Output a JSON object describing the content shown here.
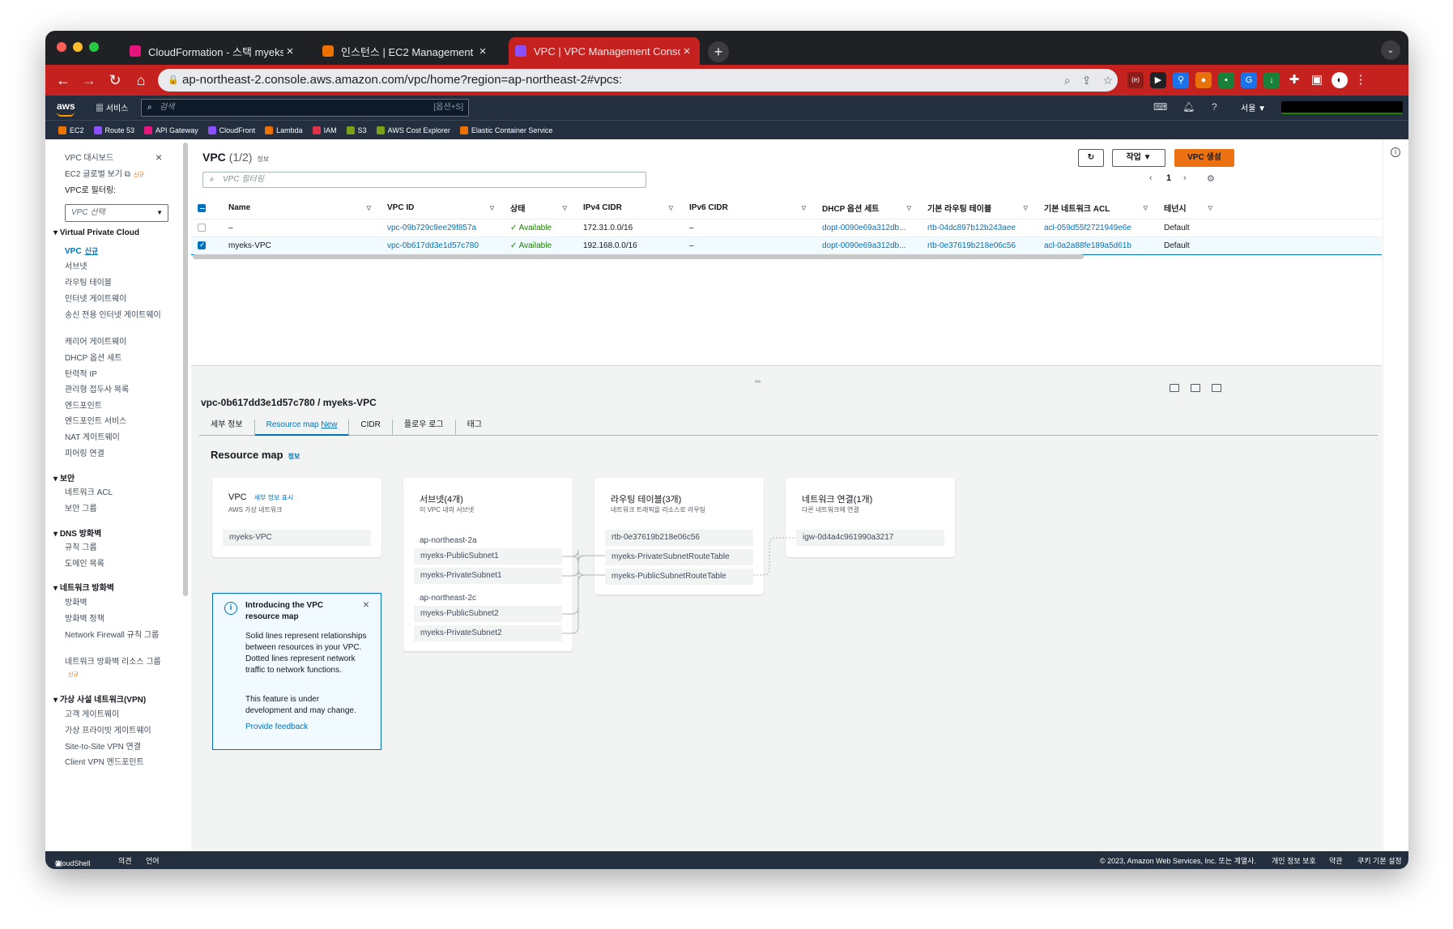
{
  "browser": {
    "tabs": [
      {
        "title": "CloudFormation - 스택 myeks",
        "color": "#e7157b"
      },
      {
        "title": "인스턴스 | EC2 Management Cor",
        "color": "#ed7100"
      },
      {
        "title": "VPC | VPC Management Conso",
        "color": "#8c4fff"
      }
    ],
    "url": "ap-northeast-2.console.aws.amazon.com/vpc/home?region=ap-northeast-2#vpcs:"
  },
  "aws_nav": {
    "logo": "aws",
    "services": "서비스",
    "search_placeholder": "검색",
    "search_shortcut": "[옵션+S]",
    "region": "서울 ▼"
  },
  "favorites": [
    {
      "label": "EC2",
      "color": "#ed7100"
    },
    {
      "label": "Route 53",
      "color": "#8c4fff"
    },
    {
      "label": "API Gateway",
      "color": "#e7157b"
    },
    {
      "label": "CloudFront",
      "color": "#8c4fff"
    },
    {
      "label": "Lambda",
      "color": "#ed7100"
    },
    {
      "label": "IAM",
      "color": "#dd344c"
    },
    {
      "label": "S3",
      "color": "#7aa116"
    },
    {
      "label": "AWS Cost Explorer",
      "color": "#7aa116"
    },
    {
      "label": "Elastic Container Service",
      "color": "#ed7100"
    }
  ],
  "sidebar": {
    "dashboard": "VPC 대시보드",
    "ec2_global": "EC2 글로벌 보기",
    "new_tag": "신규",
    "filter_label": "VPC로 필터링:",
    "filter_select": "VPC 선택",
    "sections": {
      "vpc": "Virtual Private Cloud",
      "security": "보안",
      "dns": "DNS 방화벽",
      "firewall": "네트워크 방화벽",
      "vpn": "가상 사설 네트워크(VPN)"
    },
    "vpc_items": [
      "VPC",
      "서브넷",
      "라우팅 테이블",
      "인터넷 게이트웨이",
      "송신 전용 인터넷 게이트웨이",
      "캐리어 게이트웨이",
      "DHCP 옵션 세트",
      "탄력적 IP",
      "관리형 접두사 목록",
      "엔드포인트",
      "엔드포인트 서비스",
      "NAT 게이트웨이",
      "피어링 연결"
    ],
    "security_items": [
      "네트워크 ACL",
      "보안 그룹"
    ],
    "dns_items": [
      "규칙 그룹",
      "도메인 목록"
    ],
    "firewall_items": [
      "방화벽",
      "방화벽 정책",
      "Network Firewall 규칙 그룹",
      "네트워크 방화벽 리소스 그룹"
    ],
    "vpn_items": [
      "고객 게이트웨이",
      "가상 프라이빗 게이트웨이",
      "Site-to-Site VPN 연결",
      "Client VPN 엔드포인트"
    ]
  },
  "vpc_list": {
    "title": "VPC",
    "count": "(1/2)",
    "info": "정보",
    "filter_placeholder": "VPC 필터링",
    "actions": "작업",
    "create": "VPC 생성",
    "page": "1",
    "columns": [
      "Name",
      "VPC ID",
      "상태",
      "IPv4 CIDR",
      "IPv6 CIDR",
      "DHCP 옵션 세트",
      "기본 라우팅 테이블",
      "기본 네트워크 ACL",
      "테넌시"
    ],
    "rows": [
      {
        "name": "–",
        "id": "vpc-09b729c9ee29f857a",
        "state": "Available",
        "ipv4": "172.31.0.0/16",
        "ipv6": "–",
        "dhcp": "dopt-0090e69a312db...",
        "rtb": "rtb-04dc897b12b243aee",
        "acl": "acl-059d55f2721949e6e",
        "tenancy": "Default",
        "selected": false
      },
      {
        "name": "myeks-VPC",
        "id": "vpc-0b617dd3e1d57c780",
        "state": "Available",
        "ipv4": "192.168.0.0/16",
        "ipv6": "–",
        "dhcp": "dopt-0090e69a312db...",
        "rtb": "rtb-0e37619b218e06c56",
        "acl": "acl-0a2a88fe189a5d61b",
        "tenancy": "Default",
        "selected": true
      }
    ]
  },
  "detail": {
    "title": "vpc-0b617dd3e1d57c780 / myeks-VPC",
    "tabs": [
      "세부 정보",
      "Resource map",
      "CIDR",
      "플로우 로그",
      "태그"
    ],
    "new_badge": "New",
    "resource_map_title": "Resource map",
    "info": "정보",
    "vpc_card": {
      "title": "VPC",
      "link": "세부 정보 표시",
      "sub": "AWS 가상 네트워크",
      "item": "myeks-VPC"
    },
    "subnet_card": {
      "title": "서브넷(4개)",
      "sub": "이 VPC 내의 서브넷",
      "az1": "ap-northeast-2a",
      "az2": "ap-northeast-2c",
      "items": [
        "myeks-PublicSubnet1",
        "myeks-PrivateSubnet1",
        "myeks-PublicSubnet2",
        "myeks-PrivateSubnet2"
      ]
    },
    "rt_card": {
      "title": "라우팅 테이블(3개)",
      "sub": "네트워크 트래픽을 리소스로 라우팅",
      "items": [
        "rtb-0e37619b218e06c56",
        "myeks-PrivateSubnetRouteTable",
        "myeks-PublicSubnetRouteTable"
      ]
    },
    "conn_card": {
      "title": "네트워크 연결(1개)",
      "sub": "다른 네트워크에 연결",
      "items": [
        "igw-0d4a4c961990a3217"
      ]
    },
    "notice": {
      "title": "Introducing the VPC resource map",
      "body": "Solid lines represent relationships between resources in your VPC. Dotted lines represent network traffic to network functions.",
      "body2": "This feature is under development and may change.",
      "link": "Provide feedback"
    }
  },
  "footer": {
    "cloudshell": "CloudShell",
    "feedback": "의견",
    "language": "언어",
    "copyright": "© 2023, Amazon Web Services, Inc. 또는 계열사.",
    "privacy": "개인 정보 보호",
    "terms": "약관",
    "cookies": "쿠키 기본 설정"
  }
}
